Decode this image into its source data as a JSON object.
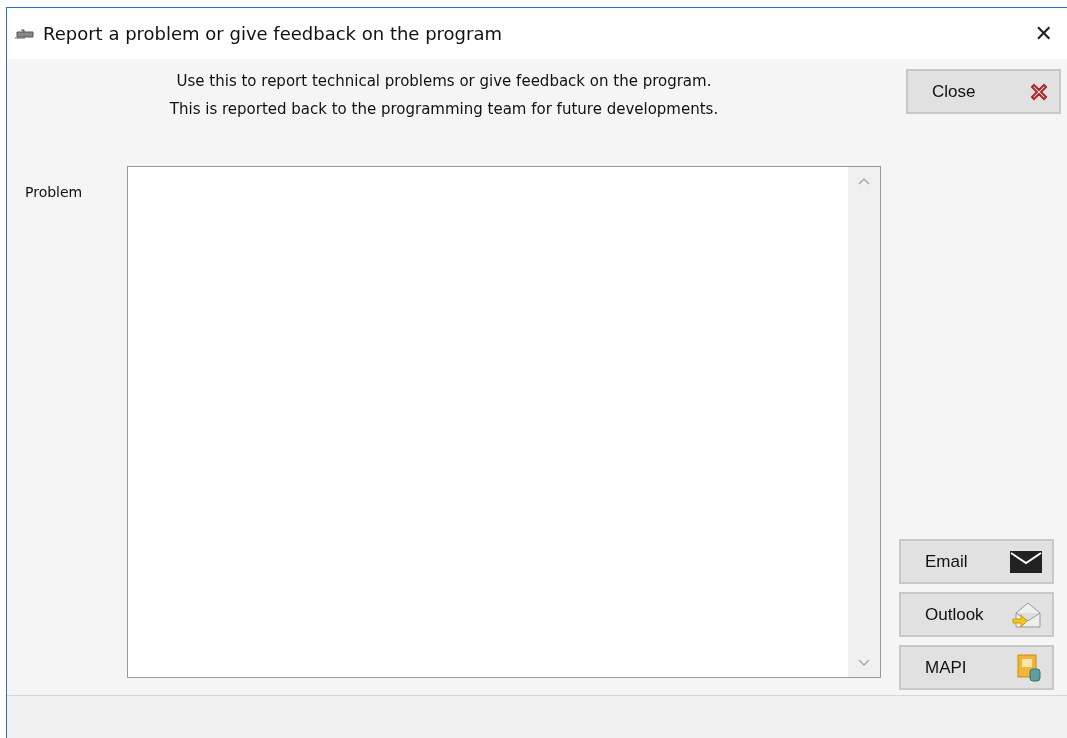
{
  "window": {
    "title": "Report a problem or give feedback on the program",
    "close_glyph": "✕"
  },
  "description": [
    "Use this to report technical problems or give feedback on the program.",
    "This is reported back to the programming team for future developments."
  ],
  "problem": {
    "label": "Problem"
  },
  "buttons": [
    {
      "label": "Close",
      "kind": "close"
    },
    {
      "label": "Email",
      "kind": "email"
    },
    {
      "label": "Outlook",
      "kind": "outlook"
    },
    {
      "label": "MAPI",
      "kind": "mapi"
    }
  ]
}
